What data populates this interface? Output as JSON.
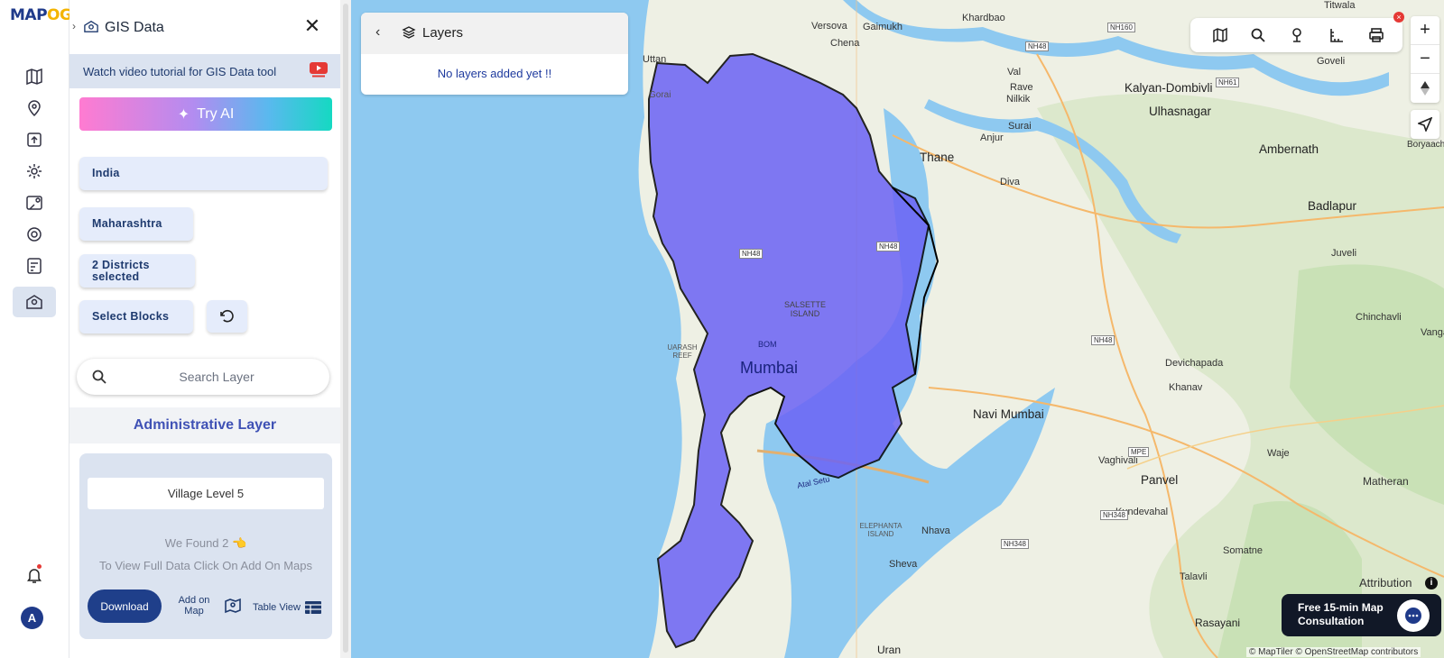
{
  "logo": {
    "text_a": "MAP",
    "text_b": "OG"
  },
  "rail": {
    "icons": [
      "map-icon",
      "location-pin-icon",
      "upload-icon",
      "settings-gear-icon",
      "map-pin-grid-icon",
      "cog-icon",
      "checklist-icon",
      "gis-data-icon"
    ],
    "avatar_initial": "A"
  },
  "panel": {
    "title": "GIS Data",
    "tutorial_text": "Watch video tutorial for GIS Data tool",
    "try_ai_label": "Try AI",
    "country": "India",
    "state": "Maharashtra",
    "districts": "2 Districts selected",
    "blocks": "Select Blocks",
    "search_placeholder": "Search Layer",
    "admin_layer_title": "Administrative Layer",
    "village_level": "Village Level 5",
    "found_text": "We Found  2 👈",
    "found_hint": "To View Full Data Click On Add On Maps",
    "download_label": "Download",
    "add_on_map_label": "Add on Map",
    "table_view_label": "Table View"
  },
  "layers": {
    "title": "Layers",
    "empty_text": "No layers added yet !!"
  },
  "map": {
    "labels": {
      "mumbai": "Mumbai",
      "thane": "Thane",
      "navi_mumbai": "Navi Mumbai",
      "kalyan": "Kalyan-Dombivli",
      "ulhasnagar": "Ulhasnagar",
      "ambernath": "Ambernath",
      "badlapur": "Badlapur",
      "panvel": "Panvel",
      "matheran": "Matheran",
      "uttan": "Uttan",
      "gorai": "Gorai",
      "versova": "Versova",
      "gaimukh": "Gaimukh",
      "chena": "Chena",
      "khar": "Khar",
      "val": "Val",
      "rave": "Rave",
      "nilkikal": "Nilkik",
      "surai": "Surai",
      "anjur": "Anjur",
      "diva": "Diva",
      "goveli": "Goveli",
      "chinchavli": "Chinchavli",
      "vangani": "Vangani",
      "juveli": "Juveli",
      "devichapada": "Devichapada",
      "khanav": "Khanav",
      "vaghivali": "Vaghivali",
      "waje": "Waje",
      "kundevahal": "Kundevahal",
      "nhava": "Nhava",
      "sheva": "Sheva",
      "somatne": "Somatne",
      "talavli": "Talavli",
      "rasayani": "Rasayani",
      "uran": "Uran",
      "boryaachi": "Boryaachi",
      "salsette": "SALSETTE ISLAND",
      "uarash_reef": "UARASH REEF",
      "elephanta": "ELEPHANTA ISLAND",
      "bom": "BOM",
      "atal_setu": "Atal Setu",
      "khardbao": "Khardbao",
      "titwala": "Titwala"
    },
    "shields": [
      "NH48",
      "NH160",
      "NH61",
      "NH48",
      "NH48",
      "NH48",
      "MPE",
      "NH348",
      "NH348"
    ]
  },
  "map_tools": [
    "map-layers-icon",
    "search-icon",
    "pin-icon",
    "measure-icon",
    "print-icon"
  ],
  "zoom": {
    "in": "+",
    "out": "−"
  },
  "consult_text": "Free 15-min Map Consultation",
  "attribution_label": "Attribution",
  "attribution_text": "© MapTiler © OpenStreetMap contributors",
  "colors": {
    "brand": "#1f3a8a",
    "boundary_fill": "#6b63f5",
    "water": "#8ec9f0"
  }
}
